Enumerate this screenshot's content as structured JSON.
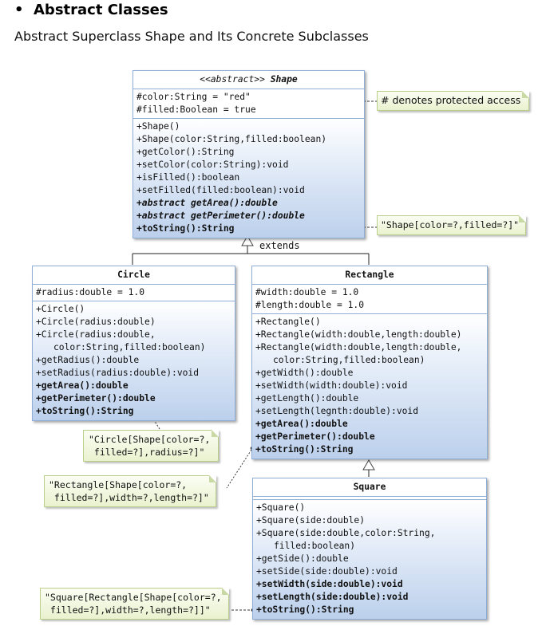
{
  "heading": {
    "bullet": "•",
    "title": "Abstract Classes"
  },
  "subtitle": "Abstract Superclass Shape and Its Concrete Subclasses",
  "colors": {
    "class_border": "#8eaed8",
    "class_gradient_end": "#bcd0ec",
    "note_border": "#b9cf8a",
    "note_fill": "#e9f2cf"
  },
  "shape": {
    "stereotype": "<<abstract>>",
    "name": "Shape",
    "attributes": [
      "#color:String = \"red\"",
      "#filled:Boolean = true"
    ],
    "operations": [
      {
        "text": "+Shape()",
        "style": "normal"
      },
      {
        "text": "+Shape(color:String,filled:boolean)",
        "style": "normal"
      },
      {
        "text": "+getColor():String",
        "style": "normal"
      },
      {
        "text": "+setColor(color:String):void",
        "style": "normal"
      },
      {
        "text": "+isFilled():boolean",
        "style": "normal"
      },
      {
        "text": "+setFilled(filled:boolean):void",
        "style": "normal"
      },
      {
        "text": "+abstract getArea():double",
        "style": "bold-italic"
      },
      {
        "text": "+abstract getPerimeter():double",
        "style": "bold-italic"
      },
      {
        "text": "+toString():String",
        "style": "bold"
      }
    ]
  },
  "circle": {
    "name": "Circle",
    "attributes": [
      "#radius:double = 1.0"
    ],
    "operations": [
      {
        "text": "+Circle()",
        "style": "normal"
      },
      {
        "text": "+Circle(radius:double)",
        "style": "normal"
      },
      {
        "text": "+Circle(radius:double,",
        "style": "normal"
      },
      {
        "text": "color:String,filled:boolean)",
        "style": "indent"
      },
      {
        "text": "+getRadius():double",
        "style": "normal"
      },
      {
        "text": "+setRadius(radius:double):void",
        "style": "normal"
      },
      {
        "text": "+getArea():double",
        "style": "bold"
      },
      {
        "text": "+getPerimeter():double",
        "style": "bold"
      },
      {
        "text": "+toString():String",
        "style": "bold"
      }
    ]
  },
  "rectangle": {
    "name": "Rectangle",
    "attributes": [
      "#width:double = 1.0",
      "#length:double = 1.0"
    ],
    "operations": [
      {
        "text": "+Rectangle()",
        "style": "normal"
      },
      {
        "text": "+Rectangle(width:double,length:double)",
        "style": "normal"
      },
      {
        "text": "+Rectangle(width:double,length:double,",
        "style": "normal"
      },
      {
        "text": "color:String,filled:boolean)",
        "style": "indent"
      },
      {
        "text": "+getWidth():double",
        "style": "normal"
      },
      {
        "text": "+setWidth(width:double):void",
        "style": "normal"
      },
      {
        "text": "+getLength():double",
        "style": "normal"
      },
      {
        "text": "+setLength(legnth:double):void",
        "style": "normal"
      },
      {
        "text": "+getArea():double",
        "style": "bold"
      },
      {
        "text": "+getPerimeter():double",
        "style": "bold"
      },
      {
        "text": "+toString():String",
        "style": "bold"
      }
    ]
  },
  "square": {
    "name": "Square",
    "attributes": [],
    "operations": [
      {
        "text": "+Square()",
        "style": "normal"
      },
      {
        "text": "+Square(side:double)",
        "style": "normal"
      },
      {
        "text": "+Square(side:double,color:String,",
        "style": "normal"
      },
      {
        "text": "filled:boolean)",
        "style": "indent"
      },
      {
        "text": "+getSide():double",
        "style": "normal"
      },
      {
        "text": "+setSide(side:double):void",
        "style": "normal"
      },
      {
        "text": "+setWidth(side:double):void",
        "style": "bold"
      },
      {
        "text": "+setLength(side:double):void",
        "style": "bold"
      },
      {
        "text": "+toString():String",
        "style": "bold"
      }
    ]
  },
  "extends_label": "extends",
  "notes": {
    "protected": [
      "# denotes protected access"
    ],
    "shape_tostring": [
      "\"Shape[color=?,filled=?]\""
    ],
    "circle_tostring": [
      "\"Circle[Shape[color=?,",
      " filled=?],radius=?]\""
    ],
    "rectangle_tostring": [
      "\"Rectangle[Shape[color=?,",
      " filled=?],width=?,length=?]\""
    ],
    "square_tostring": [
      "\"Square[Rectangle[Shape[color=?,",
      " filled=?],width=?,length=?]]\""
    ]
  }
}
